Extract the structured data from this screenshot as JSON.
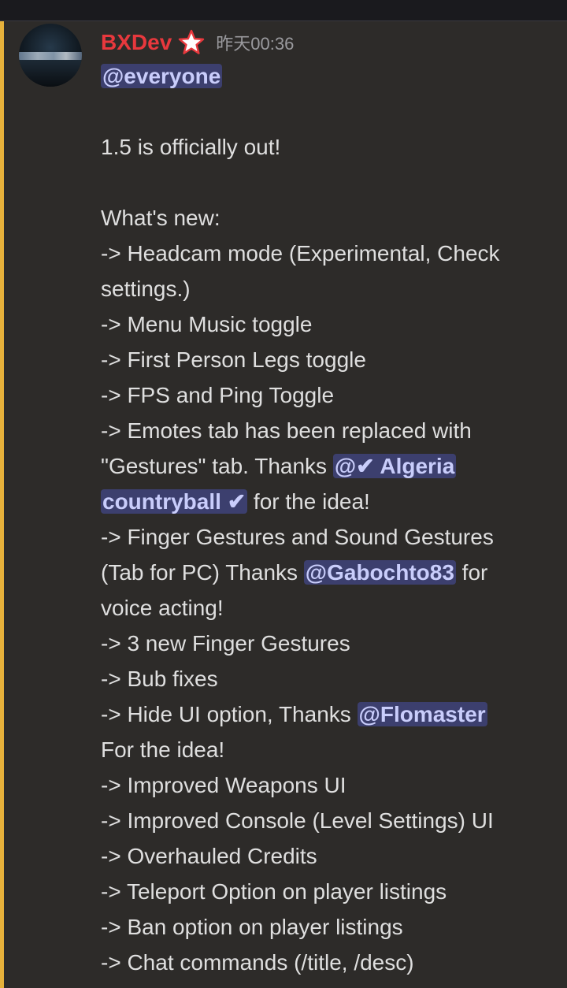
{
  "author": {
    "name": "BXDev",
    "badge_icon": "star-icon",
    "timestamp": "昨天00:36",
    "avatar": "avatar-night-city"
  },
  "colors": {
    "username": "#e8383d",
    "mention_bg": "#3c3f6e",
    "mention_text": "#c9cdfb",
    "highlight_strip": "#e6b13b"
  },
  "message": {
    "mention_everyone": "@everyone",
    "line_1": "1.5 is officially out!",
    "line_2": "What's new:",
    "line_3a": "-> Headcam mode (Experimental, Check",
    "line_3b": "settings.)",
    "line_4": "-> Menu Music toggle",
    "line_5": "-> First Person Legs toggle",
    "line_6": "-> FPS and Ping Toggle",
    "line_7a": "-> Emotes tab has been replaced with",
    "line_7b_pre": "\"Gestures\" tab. Thanks ",
    "mention_algeria_1": "@✔ Algeria",
    "mention_algeria_2": "countryball ✔",
    "line_7c_post": " for the idea!",
    "line_8a": "-> Finger Gestures and Sound Gestures",
    "line_8b_pre": "(Tab for PC) Thanks ",
    "mention_gabochto": "@Gabochto83",
    "line_8b_post": " for",
    "line_8c": "voice acting!",
    "line_9": "-> 3 new Finger Gestures",
    "line_10": "-> Bub fixes",
    "line_11a_pre": "-> Hide UI option, Thanks ",
    "mention_flomaster": "@Flomaster",
    "line_11b": "For the idea!",
    "line_12": "-> Improved Weapons UI",
    "line_13": "-> Improved Console (Level Settings) UI",
    "line_14": "-> Overhauled Credits",
    "line_15": "-> Teleport Option on player listings",
    "line_16": "-> Ban option on player listings",
    "line_17": "-> Chat commands (/title, /desc)"
  }
}
